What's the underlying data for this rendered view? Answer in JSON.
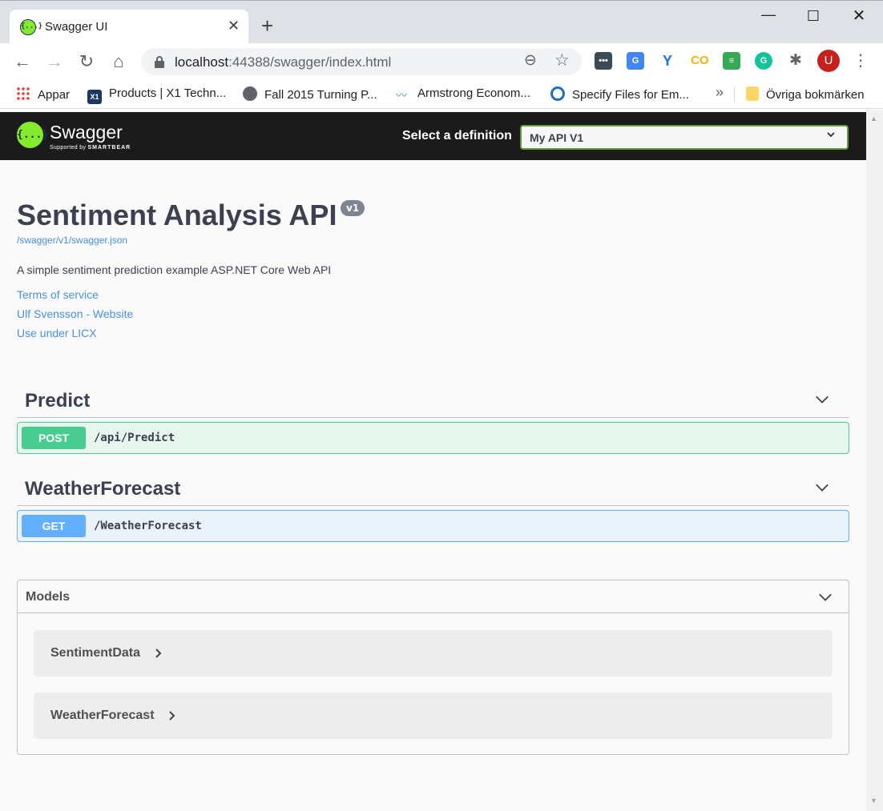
{
  "browser": {
    "tab_title": "Swagger UI",
    "favicon_glyph": "{...}",
    "url_host": "localhost",
    "url_rest": ":44388/swagger/index.html",
    "profile_initial": "U",
    "bookmarks": [
      {
        "label": "Appar"
      },
      {
        "label": "Products | X1 Techn..."
      },
      {
        "label": "Fall 2015 Turning P..."
      },
      {
        "label": "Armstrong Econom..."
      },
      {
        "label": "Specify Files for Em..."
      }
    ],
    "bookmarks_more": "»",
    "other_bookmarks": "Övriga bokmärken",
    "icons": {
      "x1": "X1",
      "ext_1": "•••",
      "ext_2": "G",
      "ext_3": "Y",
      "ext_4": "CO",
      "ext_5": "≡",
      "ext_6": "G"
    }
  },
  "swagger": {
    "logo_glyph": "{...}",
    "logo_text": "Swagger",
    "logo_sub_prefix": "Supported by",
    "logo_sub_brand": "SMARTBEAR",
    "definition_label": "Select a definition",
    "definition_selected": "My API V1",
    "accent_color": "#85ea2d"
  },
  "info": {
    "title": "Sentiment Analysis API",
    "version": "v1",
    "spec_url": "/swagger/v1/swagger.json",
    "description": "A simple sentiment prediction example ASP.NET Core Web API",
    "links": {
      "terms": "Terms of service",
      "contact": "Ulf Svensson - Website",
      "license": "Use under LICX"
    }
  },
  "tags": [
    {
      "name": "Predict",
      "operation": {
        "method": "POST",
        "path": "/api/Predict",
        "color": "#49cc90"
      }
    },
    {
      "name": "WeatherForecast",
      "operation": {
        "method": "GET",
        "path": "/WeatherForecast",
        "color": "#61affe"
      }
    }
  ],
  "models": {
    "title": "Models",
    "items": [
      {
        "name": "SentimentData"
      },
      {
        "name": "WeatherForecast"
      }
    ]
  }
}
